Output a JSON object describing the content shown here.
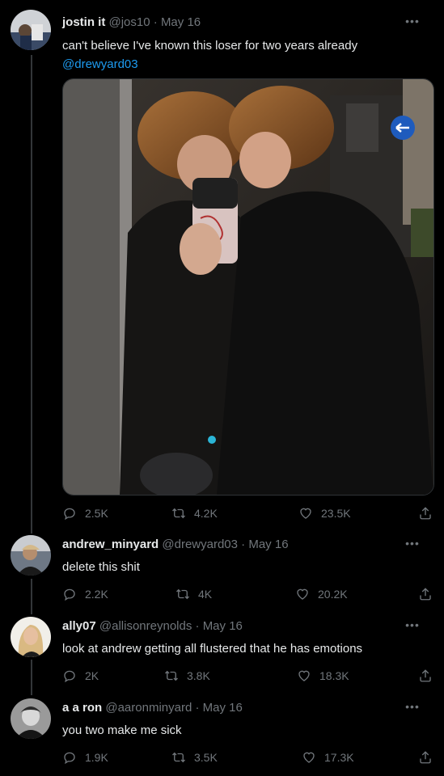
{
  "tweets": [
    {
      "name": "jostin it",
      "handle": "@jos10",
      "date": "May 16",
      "text": "can't believe I've known this loser for two years already",
      "mention": "@drewyard03",
      "replies": "2.5K",
      "retweets": "4.2K",
      "likes": "23.5K"
    },
    {
      "name": "andrew_minyard",
      "handle": "@drewyard03",
      "date": "May 16",
      "text": "delete this shit",
      "replies": "2.2K",
      "retweets": "4K",
      "likes": "20.2K"
    },
    {
      "name": "ally07",
      "handle": "@allisonreynolds",
      "date": "May 16",
      "text": "look at andrew getting all flustered that he has emotions",
      "replies": "2K",
      "retweets": "3.8K",
      "likes": "18.3K"
    },
    {
      "name": "a a ron",
      "handle": "@aaronminyard",
      "date": "May 16",
      "text": "you two make me sick",
      "replies": "1.9K",
      "retweets": "3.5K",
      "likes": "17.3K"
    }
  ],
  "separator": " · ",
  "more_label": "•••",
  "colors": {
    "background": "#000000",
    "text": "#e7e9ea",
    "muted": "#71767b",
    "link": "#1d9bf0"
  }
}
